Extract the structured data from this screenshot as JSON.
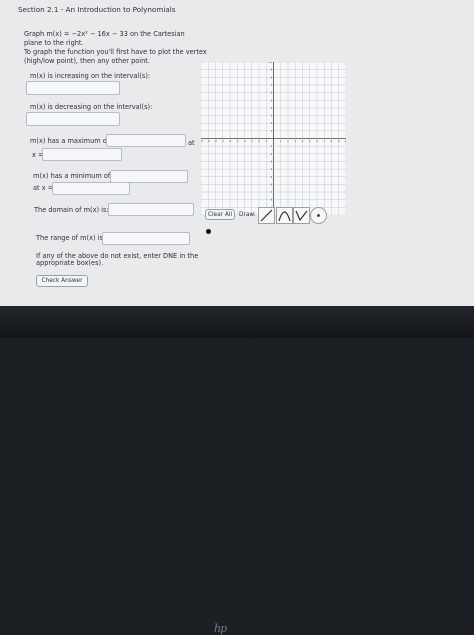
{
  "section_title": "Section 2.1 - An Introduction to Polynomials",
  "problem": {
    "line1": "Graph m(x) = −2x² − 16x − 33 on the Cartesian",
    "line2": "plane to the right.",
    "line3": "To graph the function you'll first have to plot the vertex",
    "line4": "(high/low point), then any other point."
  },
  "questions": {
    "increasing": "m(x) is increasing on the interval(s):",
    "decreasing": "m(x) is decreasing on the interval(s):",
    "maximum": "m(x) has a maximum of",
    "at": "at",
    "x_eq": "x =",
    "minimum": "m(x) has a minimum of",
    "at_x": "at x =",
    "domain": "The domain of m(x) is:",
    "range": "The range of m(x) is:",
    "dne_line1": "If any of the above do not exist, enter DNE in the",
    "dne_line2": "appropriate box(es)."
  },
  "graph_tools": {
    "clear_all": "Clear All",
    "draw_label": "Draw:",
    "tool_icons": [
      "line-icon",
      "parabola-icon",
      "check-curve-icon",
      "point-icon"
    ]
  },
  "check_button": "Check Answer",
  "axis": {
    "x_ticks": [
      "-10",
      "-9",
      "-8",
      "-7",
      "-6",
      "-5",
      "-4",
      "-3",
      "-2",
      "-1",
      "1",
      "2",
      "3",
      "4",
      "5",
      "6",
      "7",
      "8",
      "9",
      "10"
    ],
    "y_ticks": [
      "10",
      "9",
      "8",
      "7",
      "6",
      "5",
      "4",
      "3",
      "2",
      "1",
      "-1",
      "-2",
      "-3",
      "-4",
      "-5",
      "-6",
      "-7",
      "-8",
      "-9",
      "-10"
    ]
  },
  "brand": "hp"
}
